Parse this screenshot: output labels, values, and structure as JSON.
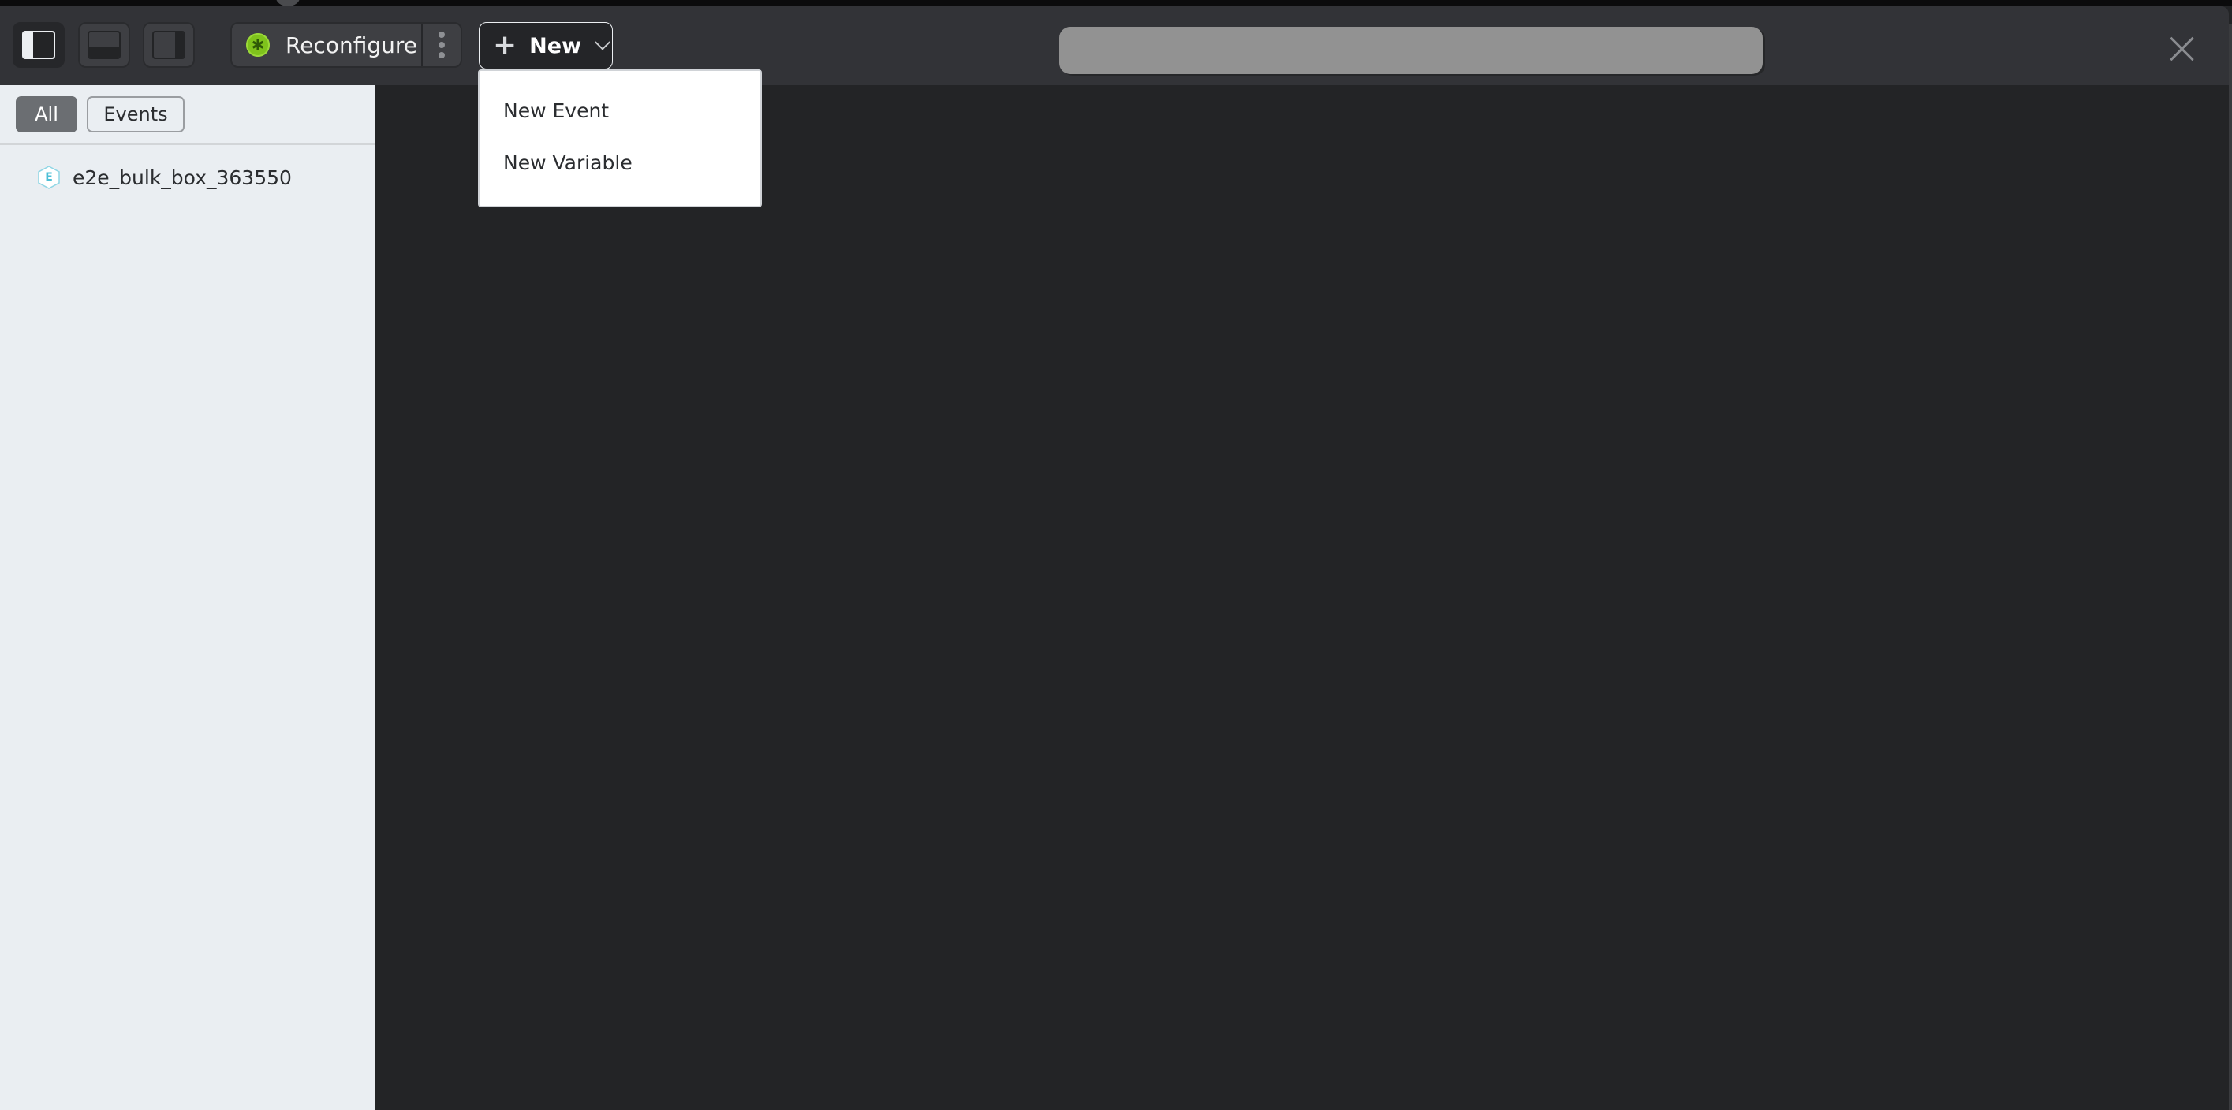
{
  "toolbar": {
    "layout_buttons": [
      {
        "name": "left-panel-layout",
        "active": true
      },
      {
        "name": "bottom-panel-layout",
        "active": false
      },
      {
        "name": "right-panel-layout",
        "active": false
      }
    ],
    "reconfigure_label": "Reconfigure",
    "reconfigure_icon": "gear-icon",
    "more_icon": "vertical-ellipsis-icon",
    "new_label": "New",
    "new_icon": "plus-icon",
    "new_chevron": "chevron-down-icon",
    "search_value": "",
    "close_icon": "close-icon"
  },
  "new_menu": {
    "items": [
      {
        "label": "New Event"
      },
      {
        "label": "New Variable"
      }
    ]
  },
  "sidebar": {
    "filters": [
      {
        "label": "All",
        "active": true
      },
      {
        "label": "Events",
        "active": false
      }
    ],
    "items": [
      {
        "type_badge": "E",
        "label": "e2e_bulk_box_363550"
      }
    ]
  },
  "colors": {
    "header_bg": "#323337",
    "main_bg": "#232426",
    "sidebar_bg": "#eaeef2",
    "accent_green": "#7fc31c",
    "event_badge": "#4cbfd6"
  }
}
